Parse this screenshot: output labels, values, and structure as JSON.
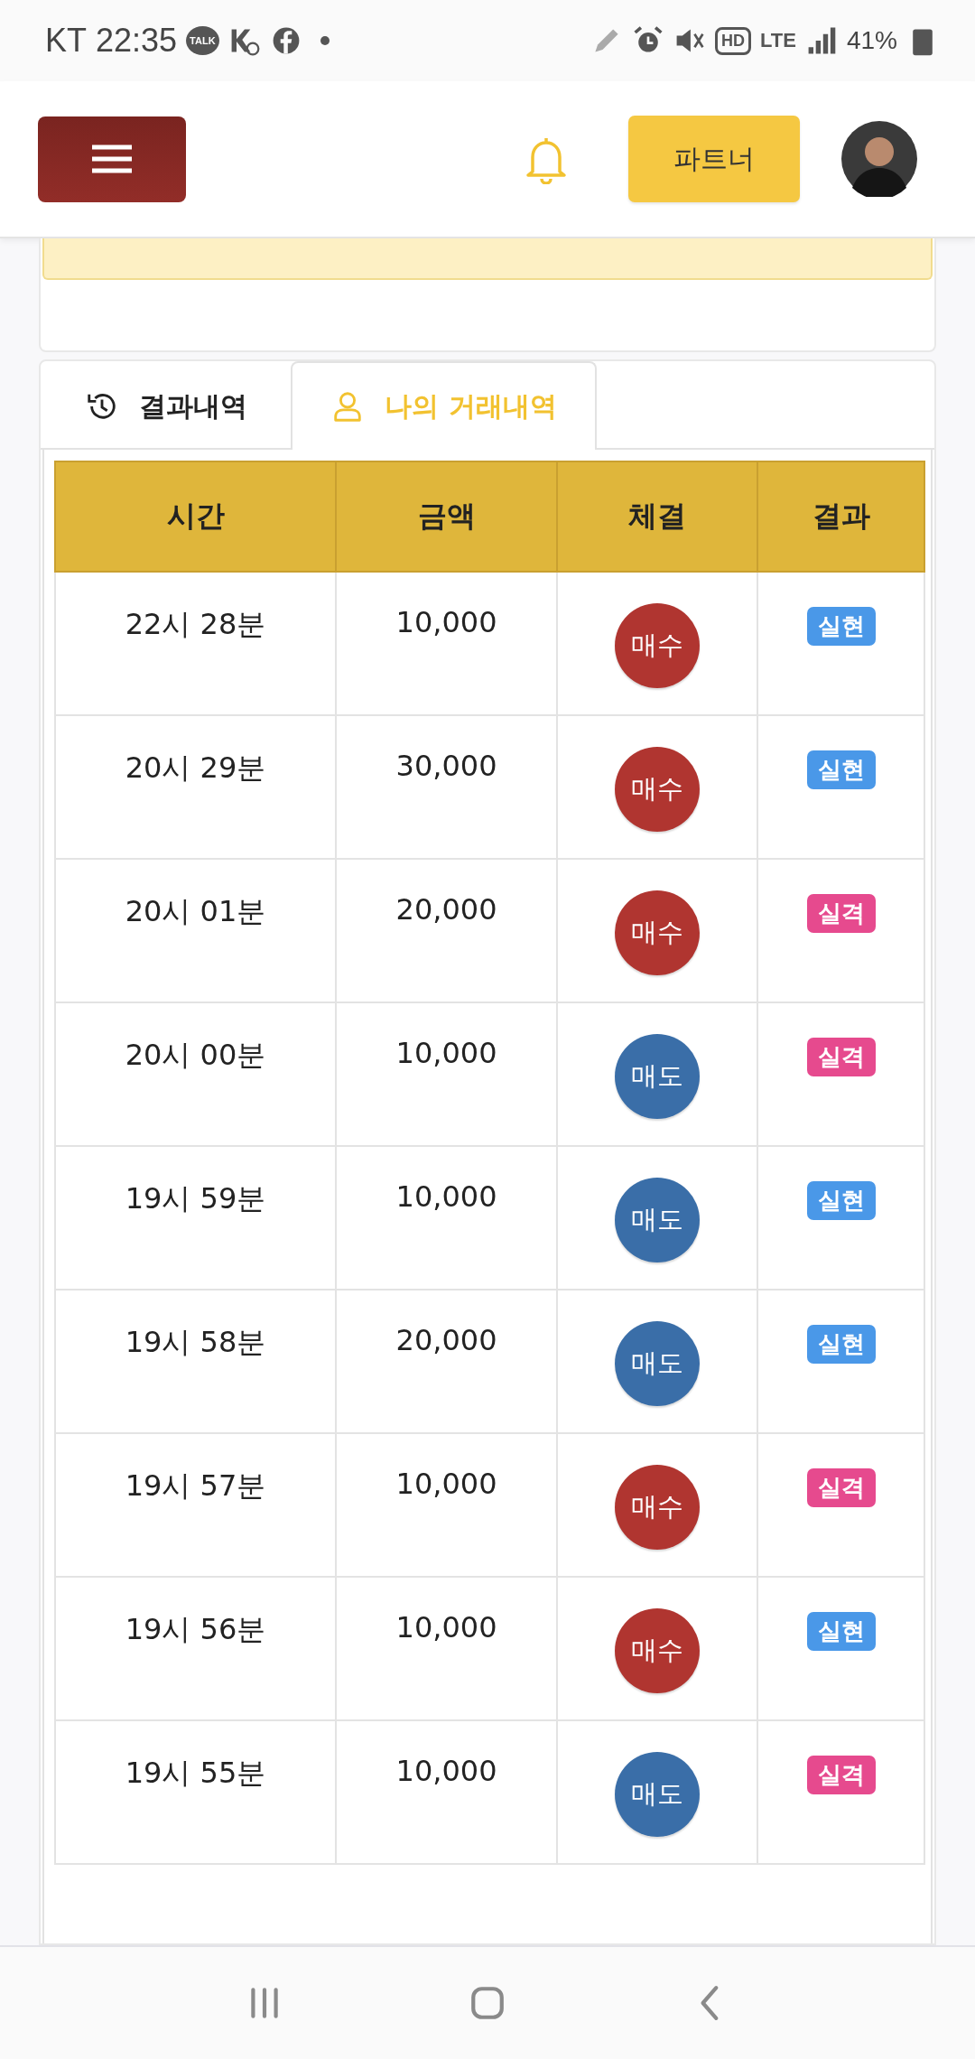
{
  "status_bar": {
    "carrier": "KT",
    "time": "22:35",
    "talk_label": "TALK",
    "hd_label": "HD",
    "network": "LTE",
    "battery": "41%"
  },
  "header": {
    "partner_button": "파트너"
  },
  "tabs": [
    {
      "label": "결과내역",
      "kind": "history",
      "selected": false
    },
    {
      "label": "나의 거래내역",
      "kind": "user",
      "selected": true
    }
  ],
  "table": {
    "columns": [
      "시간",
      "금액",
      "체결",
      "결과"
    ],
    "rows": [
      {
        "time": "22시 28분",
        "amount": "10,000",
        "trade": {
          "label": "매수",
          "kind": "buy"
        },
        "result": {
          "label": "실현",
          "kind": "hit"
        }
      },
      {
        "time": "20시 29분",
        "amount": "30,000",
        "trade": {
          "label": "매수",
          "kind": "buy"
        },
        "result": {
          "label": "실현",
          "kind": "hit"
        }
      },
      {
        "time": "20시 01분",
        "amount": "20,000",
        "trade": {
          "label": "매수",
          "kind": "buy"
        },
        "result": {
          "label": "실격",
          "kind": "miss"
        }
      },
      {
        "time": "20시 00분",
        "amount": "10,000",
        "trade": {
          "label": "매도",
          "kind": "sell"
        },
        "result": {
          "label": "실격",
          "kind": "miss"
        }
      },
      {
        "time": "19시 59분",
        "amount": "10,000",
        "trade": {
          "label": "매도",
          "kind": "sell"
        },
        "result": {
          "label": "실현",
          "kind": "hit"
        }
      },
      {
        "time": "19시 58분",
        "amount": "20,000",
        "trade": {
          "label": "매도",
          "kind": "sell"
        },
        "result": {
          "label": "실현",
          "kind": "hit"
        }
      },
      {
        "time": "19시 57분",
        "amount": "10,000",
        "trade": {
          "label": "매수",
          "kind": "buy"
        },
        "result": {
          "label": "실격",
          "kind": "miss"
        }
      },
      {
        "time": "19시 56분",
        "amount": "10,000",
        "trade": {
          "label": "매수",
          "kind": "buy"
        },
        "result": {
          "label": "실현",
          "kind": "hit"
        }
      },
      {
        "time": "19시 55분",
        "amount": "10,000",
        "trade": {
          "label": "매도",
          "kind": "sell"
        },
        "result": {
          "label": "실격",
          "kind": "miss"
        }
      }
    ]
  }
}
